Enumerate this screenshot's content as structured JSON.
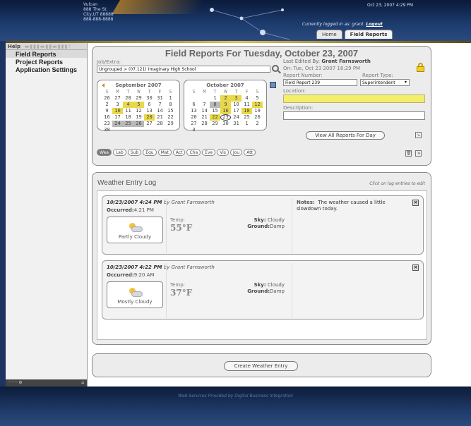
{
  "header": {
    "address_lines": [
      "Vulcan",
      "888 The St.",
      "City,UT 88888",
      "888-888-8888"
    ],
    "datetime": "Oct 23, 2007 4:29 PM",
    "logged_in_prefix": "Currently logged in as:",
    "user": "grant.",
    "logout": "Logout",
    "tabs": [
      {
        "label": "Home",
        "active": false
      },
      {
        "label": "Field Reports",
        "active": true
      }
    ]
  },
  "sidebar": {
    "help_label": "Help",
    "items": [
      {
        "label": "Field Reports",
        "active": true
      },
      {
        "label": "Project Reports",
        "active": false
      },
      {
        "label": "Application Settings",
        "active": false
      }
    ],
    "footer_text": "·······  ⚙"
  },
  "report": {
    "title": "Field Reports For Tuesday, October 23, 2007",
    "job_label": "Job/Extra:",
    "job_value": "Ungrouped > (07.121) Imaginary High School",
    "last_edited": "Last Edited By:",
    "last_edited_name": "Grant Farnsworth",
    "last_edited_on": "On: Tue, Oct 23 2007 16:29 PM",
    "report_number_label": "Report Number:",
    "report_number_value": "Field Report 239",
    "report_type_label": "Report Type:",
    "report_type_value": "Superintendent",
    "location_label": "Location:",
    "description_label": "Description:",
    "view_all_label": "View All Reports For Day",
    "category_buttons": [
      "Wea",
      "Lab",
      "Sub",
      "Equ",
      "Mat",
      "Act",
      "Cha",
      "Eve",
      "Vis",
      "Jou",
      "Att"
    ],
    "calendars": [
      {
        "month": "September 2007",
        "days": [
          "26",
          "27",
          "28",
          "29",
          "30",
          "31",
          "1",
          "2",
          "3",
          "4",
          "5",
          "6",
          "7",
          "8",
          "9",
          "10",
          "11",
          "12",
          "13",
          "14",
          "15",
          "16",
          "17",
          "18",
          "19",
          "20",
          "21",
          "22",
          "23",
          "24",
          "25",
          "26",
          "27",
          "28",
          "29",
          "30"
        ]
      },
      {
        "month": "October 2007",
        "days": [
          "",
          "",
          "1",
          "2",
          "3",
          "4",
          "5",
          "6",
          "7",
          "8",
          "9",
          "10",
          "11",
          "12",
          "13",
          "14",
          "15",
          "16",
          "17",
          "18",
          "19",
          "20",
          "21",
          "22",
          "23",
          "24",
          "25",
          "26",
          "27",
          "28",
          "29",
          "30",
          "31",
          "1",
          "2",
          "3"
        ]
      }
    ],
    "weekday_letters": [
      "S",
      "M",
      "T",
      "W",
      "T",
      "F",
      "S"
    ]
  },
  "weather_log": {
    "title": "Weather Entry Log",
    "hint": "Click on log entries to edit",
    "entries": [
      {
        "stamp": "10/23/2007 4:24 PM",
        "by": "by Grant Farnsworth",
        "occurred_label": "Occurred:",
        "occurred": "4:21 PM",
        "condition": "Partly Cloudy",
        "temp_label": "Temp:",
        "temp": "55°F",
        "sky_label": "Sky:",
        "sky": "Cloudy",
        "ground_label": "Ground:",
        "ground": "Damp",
        "notes_label": "Notes:",
        "notes": "The weather caused a little slowdown today."
      },
      {
        "stamp": "10/23/2007 4:22 PM",
        "by": "by Grant Farnsworth",
        "occurred_label": "Occurred:",
        "occurred": "9:20 AM",
        "condition": "Mostly Cloudy",
        "temp_label": "Temp:",
        "temp": "37°F",
        "sky_label": "Sky:",
        "sky": "Cloudy",
        "ground_label": "Ground:",
        "ground": "Damp",
        "notes_label": "",
        "notes": ""
      }
    ]
  },
  "create_button": "Create Weather Entry",
  "footer": {
    "credit": "Web Services Provided by Digital Business Integration"
  }
}
